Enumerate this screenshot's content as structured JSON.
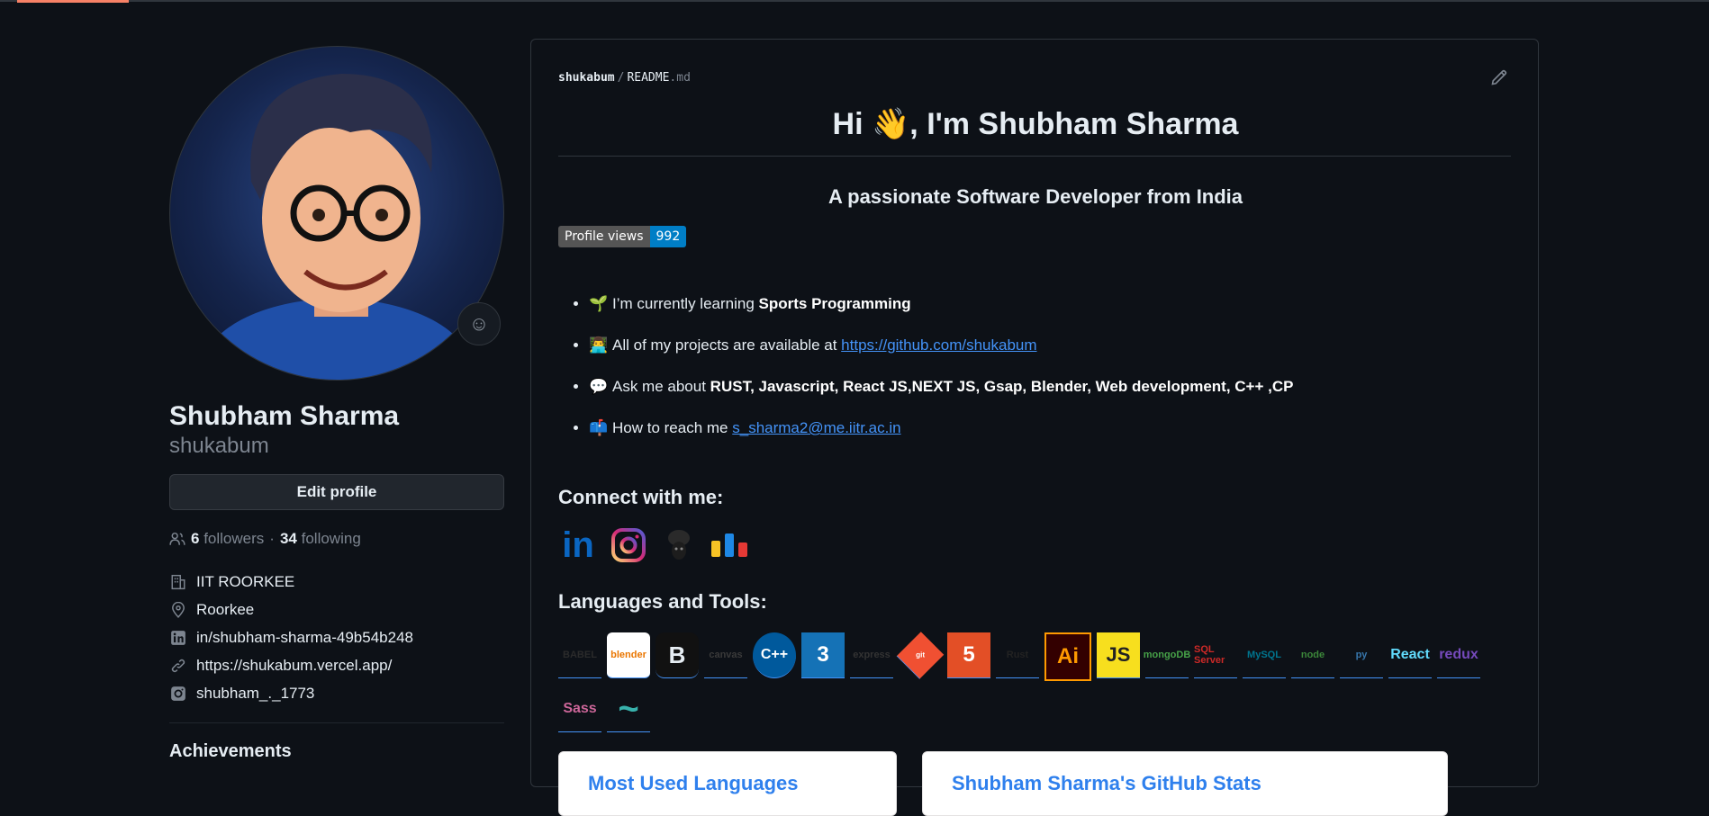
{
  "profile": {
    "name": "Shubham Sharma",
    "login": "shukabum",
    "edit_label": "Edit profile",
    "followers_count": "6",
    "followers_label": "followers",
    "following_count": "34",
    "following_label": "following",
    "separator": "·",
    "details": {
      "org": "IIT ROORKEE",
      "location": "Roorkee",
      "linkedin": "in/shubham-sharma-49b54b248",
      "website": "https://shukabum.vercel.app/",
      "instagram": "shubham_._1773"
    },
    "achievements_label": "Achievements"
  },
  "readme": {
    "crumb_user": "shukabum",
    "crumb_sep": "/",
    "crumb_file": "README",
    "crumb_ext": ".md",
    "title": "Hi 👋, I'm Shubham Sharma",
    "subtitle": "A passionate Software Developer from India",
    "badge_label": "Profile views",
    "badge_value": "992",
    "items": [
      {
        "emoji": "🌱",
        "text": "I’m currently learning ",
        "bold": "Sports Programming"
      },
      {
        "emoji": "👨‍💻",
        "text": "All of my projects are available at ",
        "link": "https://github.com/shukabum"
      },
      {
        "emoji": "💬",
        "text": "Ask me about ",
        "bold": "RUST, Javascript, React JS,NEXT JS, Gsap, Blender, Web development, C++ ,CP"
      },
      {
        "emoji": "📫",
        "text": "How to reach me ",
        "link": "s_sharma2@me.iitr.ac.in"
      }
    ],
    "connect_heading": "Connect with me:",
    "social_icons": [
      "linkedin-icon",
      "instagram-icon",
      "codechef-icon",
      "codeforces-icon"
    ],
    "social_text": {
      "linkedin": "in"
    },
    "tools_heading": "Languages and Tools:",
    "tools": [
      {
        "name": "babel",
        "label": "BABEL",
        "color": "#2b2b2b"
      },
      {
        "name": "blender",
        "label": "blender",
        "color": "#ea7600"
      },
      {
        "name": "bootstrap",
        "label": "B",
        "color": "#e6edf3"
      },
      {
        "name": "canvas",
        "label": "canvas",
        "color": "#3a3a3a"
      },
      {
        "name": "cplusplus",
        "label": "C++",
        "color": "#00599c"
      },
      {
        "name": "css3",
        "label": "3",
        "color": "#1572b6"
      },
      {
        "name": "express",
        "label": "express",
        "color": "#333"
      },
      {
        "name": "git",
        "label": "git",
        "color": "#f05032"
      },
      {
        "name": "html5",
        "label": "5",
        "color": "#e34f26"
      },
      {
        "name": "rust",
        "label": "Rust",
        "color": "#222"
      },
      {
        "name": "illustrator",
        "label": "Ai",
        "color": "#ff9a00"
      },
      {
        "name": "javascript",
        "label": "JS",
        "color": "#f7df1e"
      },
      {
        "name": "mongodb",
        "label": "mongoDB",
        "color": "#47a248"
      },
      {
        "name": "mssql",
        "label": "SQL Server",
        "color": "#cc2927"
      },
      {
        "name": "mysql",
        "label": "MySQL",
        "color": "#00758f"
      },
      {
        "name": "nodejs",
        "label": "node",
        "color": "#3c873a"
      },
      {
        "name": "python",
        "label": "py",
        "color": "#3776ab"
      },
      {
        "name": "react",
        "label": "React",
        "color": "#61dafb"
      },
      {
        "name": "redux",
        "label": "redux",
        "color": "#764abc"
      },
      {
        "name": "sass",
        "label": "Sass",
        "color": "#cc6699"
      },
      {
        "name": "tailwind",
        "label": "~",
        "color": "#38b2ac"
      }
    ],
    "stats_cards": [
      "Most Used Languages",
      "Shubham Sharma's GitHub Stats"
    ]
  },
  "colors": {
    "background": "#0d1117",
    "link": "#4493f8",
    "accent": "#f78166"
  }
}
